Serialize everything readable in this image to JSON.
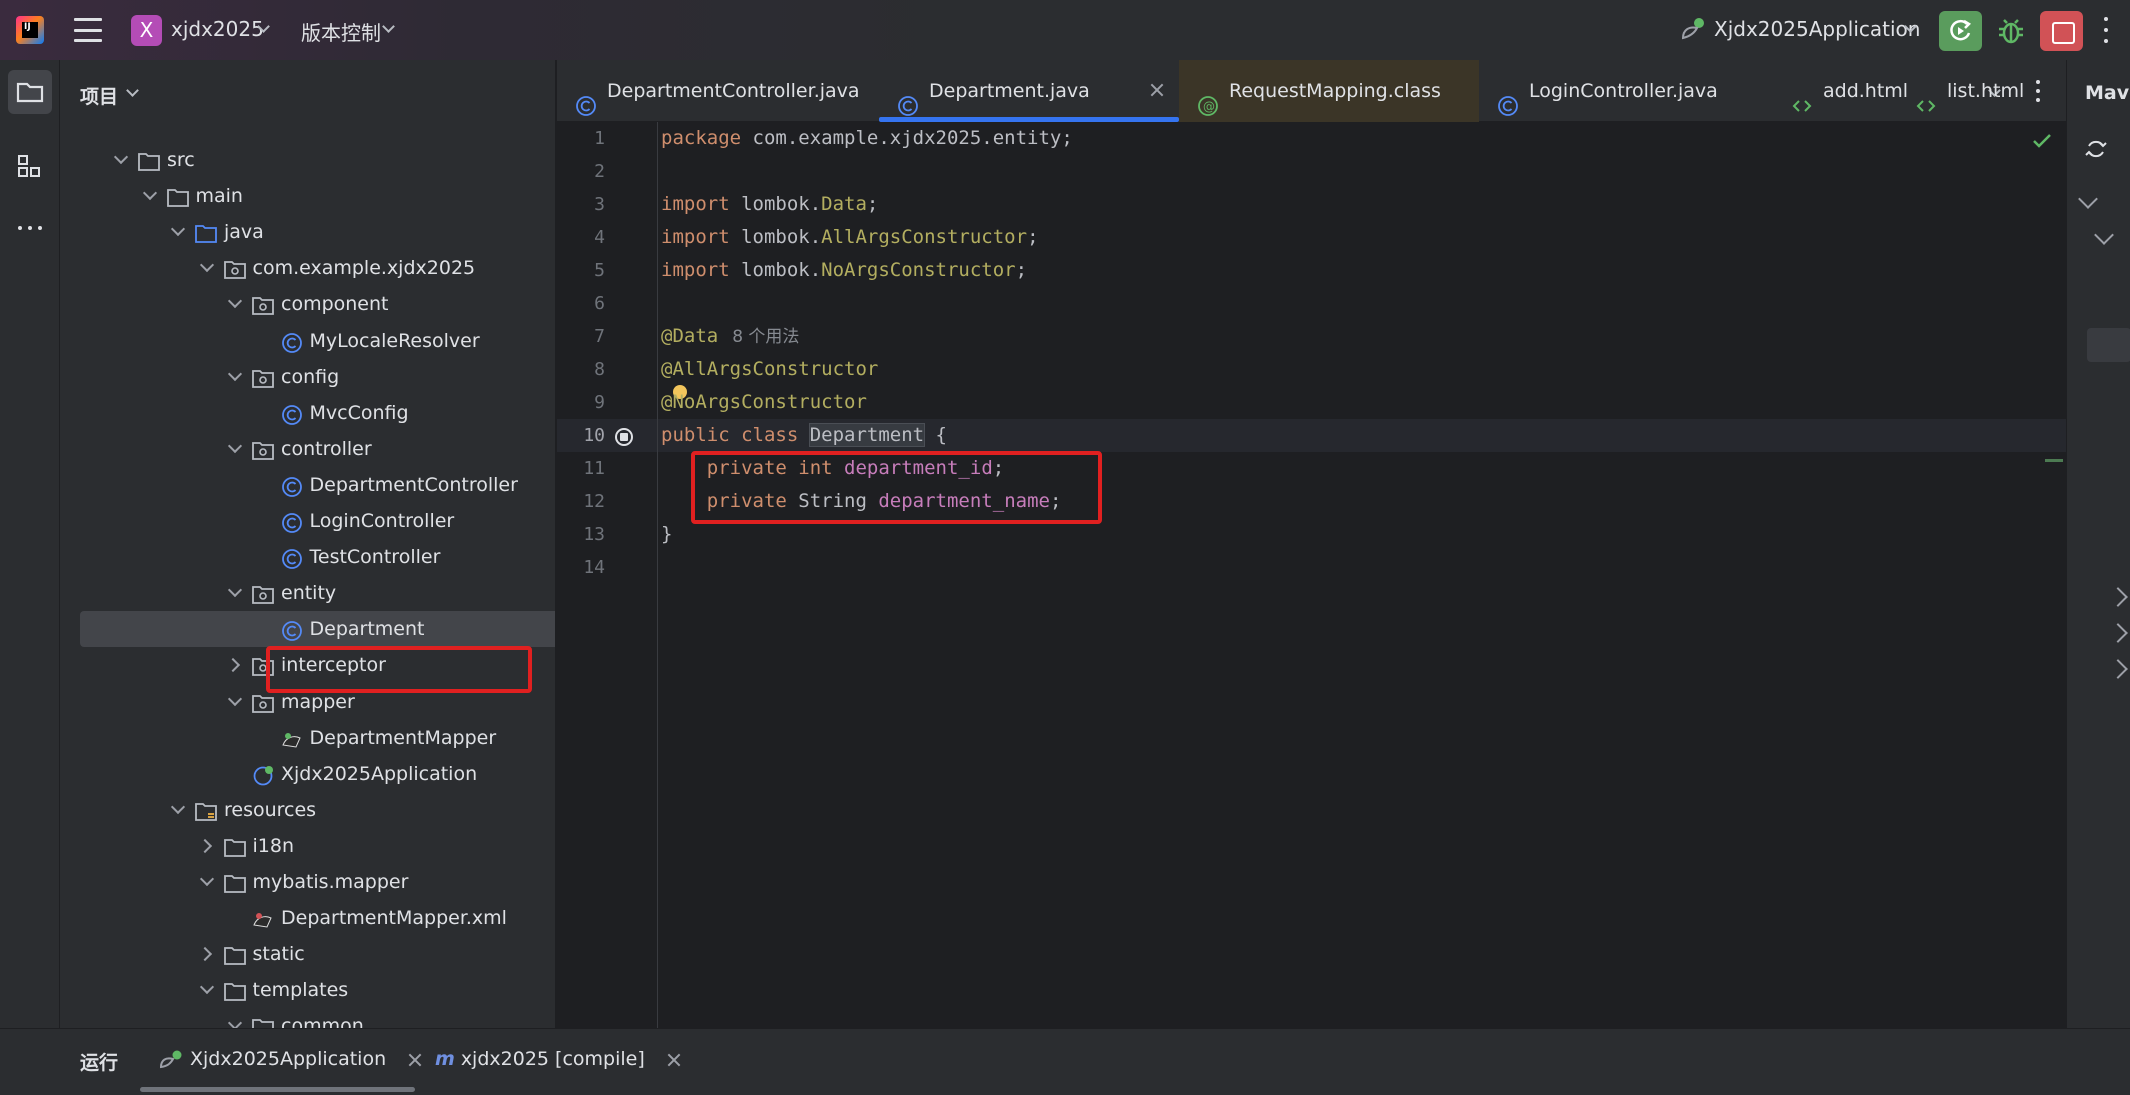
{
  "titlebar": {
    "logo_text": "IJ",
    "project_badge": "X",
    "project_name": "xjdx2025",
    "vcs_label": "版本控制",
    "run_config": "Xjdx2025Application"
  },
  "project_panel": {
    "title": "项目",
    "tree": [
      {
        "label": "src",
        "depth": 0,
        "arrow": "down",
        "icon": "folder-icon"
      },
      {
        "label": "main",
        "depth": 1,
        "arrow": "down",
        "icon": "folder-icon"
      },
      {
        "label": "java",
        "depth": 2,
        "arrow": "down",
        "icon": "source-folder-icon"
      },
      {
        "label": "com.example.xjdx2025",
        "depth": 3,
        "arrow": "down",
        "icon": "package-icon"
      },
      {
        "label": "component",
        "depth": 4,
        "arrow": "down",
        "icon": "package-icon"
      },
      {
        "label": "MyLocaleResolver",
        "depth": 5,
        "arrow": "none",
        "icon": "class-icon"
      },
      {
        "label": "config",
        "depth": 4,
        "arrow": "down",
        "icon": "package-icon"
      },
      {
        "label": "MvcConfig",
        "depth": 5,
        "arrow": "none",
        "icon": "class-icon"
      },
      {
        "label": "controller",
        "depth": 4,
        "arrow": "down",
        "icon": "package-icon"
      },
      {
        "label": "DepartmentController",
        "depth": 5,
        "arrow": "none",
        "icon": "class-icon"
      },
      {
        "label": "LoginController",
        "depth": 5,
        "arrow": "none",
        "icon": "class-icon"
      },
      {
        "label": "TestController",
        "depth": 5,
        "arrow": "none",
        "icon": "class-icon"
      },
      {
        "label": "entity",
        "depth": 4,
        "arrow": "down",
        "icon": "package-icon"
      },
      {
        "label": "Department",
        "depth": 5,
        "arrow": "none",
        "icon": "class-icon",
        "selected": true
      },
      {
        "label": "interceptor",
        "depth": 4,
        "arrow": "right",
        "icon": "package-icon"
      },
      {
        "label": "mapper",
        "depth": 4,
        "arrow": "down",
        "icon": "package-icon"
      },
      {
        "label": "DepartmentMapper",
        "depth": 5,
        "arrow": "none",
        "icon": "mybatis-icon"
      },
      {
        "label": "Xjdx2025Application",
        "depth": 4,
        "arrow": "none",
        "icon": "spring-app-icon"
      },
      {
        "label": "resources",
        "depth": 2,
        "arrow": "down",
        "icon": "resources-folder-icon"
      },
      {
        "label": "i18n",
        "depth": 3,
        "arrow": "right",
        "icon": "folder-icon"
      },
      {
        "label": "mybatis.mapper",
        "depth": 3,
        "arrow": "down",
        "icon": "folder-icon"
      },
      {
        "label": "DepartmentMapper.xml",
        "depth": 4,
        "arrow": "none",
        "icon": "mybatis-xml-icon"
      },
      {
        "label": "static",
        "depth": 3,
        "arrow": "right",
        "icon": "folder-icon"
      },
      {
        "label": "templates",
        "depth": 3,
        "arrow": "down",
        "icon": "folder-icon"
      },
      {
        "label": "common",
        "depth": 4,
        "arrow": "down",
        "icon": "folder-icon"
      }
    ]
  },
  "tabs": [
    {
      "label": "DepartmentController.java",
      "icon": "class-icon"
    },
    {
      "label": "Department.java",
      "icon": "class-icon",
      "active": true
    },
    {
      "label": "RequestMapping.class",
      "icon": "annotation-icon"
    },
    {
      "label": "LoginController.java",
      "icon": "class-icon"
    },
    {
      "label": "add.html",
      "icon": "html-icon"
    },
    {
      "label": "list.html",
      "icon": "html-icon"
    }
  ],
  "editor": {
    "lines": [
      {
        "n": "1",
        "tokens": [
          [
            "kw",
            "package"
          ],
          [
            "cls",
            " com.example.xjdx2025.entity;"
          ]
        ]
      },
      {
        "n": "2",
        "tokens": []
      },
      {
        "n": "3",
        "tokens": [
          [
            "kw",
            "import"
          ],
          [
            "cls",
            " lombok."
          ],
          [
            "imp",
            "Data"
          ],
          [
            "cls",
            ";"
          ]
        ]
      },
      {
        "n": "4",
        "tokens": [
          [
            "kw",
            "import"
          ],
          [
            "cls",
            " lombok."
          ],
          [
            "imp",
            "AllArgsConstructor"
          ],
          [
            "cls",
            ";"
          ]
        ]
      },
      {
        "n": "5",
        "tokens": [
          [
            "kw",
            "import"
          ],
          [
            "cls",
            " lombok."
          ],
          [
            "imp",
            "NoArgsConstructor"
          ],
          [
            "cls",
            ";"
          ]
        ]
      },
      {
        "n": "6",
        "tokens": []
      },
      {
        "n": "7",
        "tokens": [
          [
            "ann",
            "@Data"
          ],
          [
            "hint",
            "8 个用法"
          ]
        ]
      },
      {
        "n": "8",
        "tokens": [
          [
            "ann",
            "@AllArgsConstructor"
          ]
        ]
      },
      {
        "n": "9",
        "tokens": [
          [
            "ann",
            "@NoArgsConstructor"
          ]
        ]
      },
      {
        "n": "10",
        "tokens": [
          [
            "kw",
            "public class "
          ],
          [
            "sel",
            "Department"
          ],
          [
            "cls",
            " {"
          ]
        ]
      },
      {
        "n": "11",
        "tokens": [
          [
            "cls",
            "    "
          ],
          [
            "kw",
            "private int "
          ],
          [
            "fld",
            "department_id"
          ],
          [
            "cls",
            ";"
          ]
        ]
      },
      {
        "n": "12",
        "tokens": [
          [
            "cls",
            "    "
          ],
          [
            "kw",
            "private "
          ],
          [
            "cls",
            "String "
          ],
          [
            "fld",
            "department_name"
          ],
          [
            "cls",
            ";"
          ]
        ]
      },
      {
        "n": "13",
        "tokens": [
          [
            "cls",
            "}"
          ]
        ]
      },
      {
        "n": "14",
        "tokens": []
      }
    ],
    "current_line": "10"
  },
  "maven_panel": {
    "title": "Maven"
  },
  "bottom": {
    "label": "运行",
    "tabs": [
      {
        "label": "Xjdx2025Application",
        "icon": "spring-run-icon"
      },
      {
        "label": "xjdx2025 [compile]",
        "icon": "maven-icon"
      }
    ]
  },
  "colors": {
    "accent": "#3574f0",
    "highlight_box": "#e02020",
    "rerun": "#5a9c5d",
    "stop": "#d15256",
    "project_badge": "#b44cb6"
  }
}
